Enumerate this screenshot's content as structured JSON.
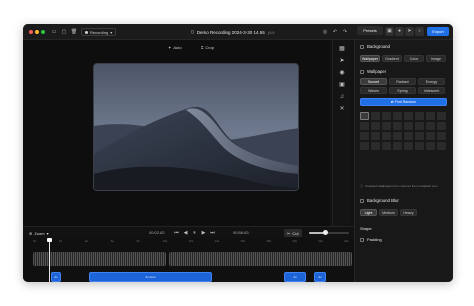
{
  "window": {
    "title": "Demo Recording 2024-3-30 14.55",
    "title_ext": "yuv",
    "recording_chip": "Recording",
    "colors": {
      "accent": "#1f6fe6",
      "close": "#ff5f57",
      "min": "#febc2e",
      "max": "#28c840"
    }
  },
  "toolbar": {
    "auto_label": "Auto",
    "crop_label": "Crop"
  },
  "header_tabs": {
    "presets": "Presets",
    "export": "Export"
  },
  "panel": {
    "background": {
      "title": "Background",
      "tabs": [
        "Wallpaper",
        "Gradient",
        "Color",
        "Image"
      ],
      "active_tab": "Wallpaper"
    },
    "wallpaper": {
      "title": "Wallpaper",
      "options": [
        "Sunset",
        "Radiant",
        "Energy",
        "Waves",
        "Spring",
        "Iridescent"
      ],
      "selected": "Sunset",
      "find_random_label": "Find Random"
    },
    "unsplash_note": "Unsplash wallpapers from sources from Unsplash.com",
    "background_blur": {
      "title": "Background Blur",
      "options": [
        "Light",
        "Medium",
        "Heavy"
      ],
      "selected": "Light"
    },
    "shape": {
      "title": "Shape"
    },
    "padding": {
      "title": "Padding"
    }
  },
  "controls": {
    "zoom_label": "Zoom",
    "current_time": "00:02.82",
    "total_time": "00:58.63",
    "cut_label": "Cut"
  },
  "timeline": {
    "ticks": [
      "0s",
      "2s",
      "4s",
      "6s",
      "8s",
      "10s",
      "12s",
      "14s",
      "16s",
      "18s",
      "20s",
      "22s",
      "24s"
    ],
    "segments": [
      {
        "label": "2x"
      },
      {
        "label": "2x Auto"
      },
      {
        "label": "2x"
      },
      {
        "label": "2x"
      }
    ],
    "playhead_value": 0.08
  }
}
